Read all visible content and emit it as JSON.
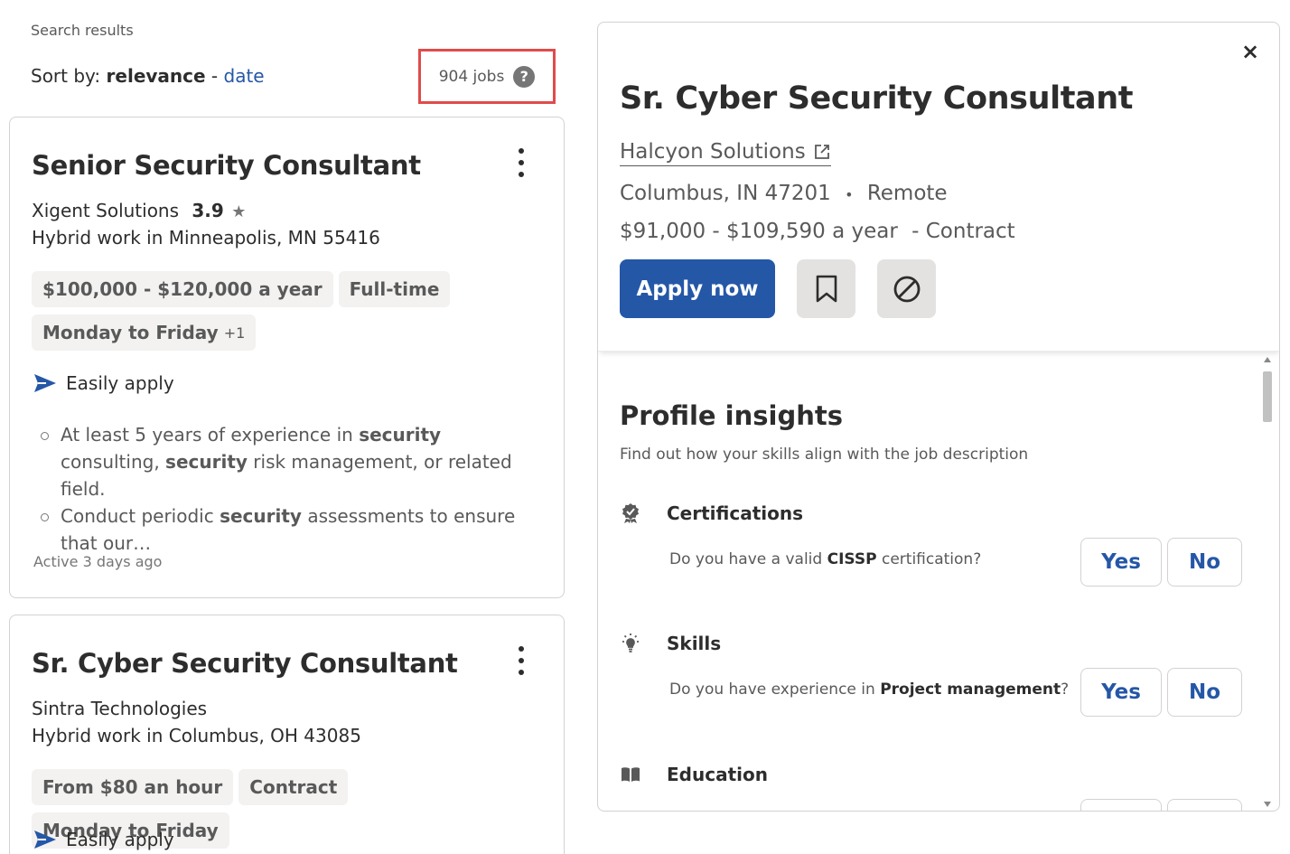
{
  "search": {
    "label": "Search results",
    "sort_prefix": "Sort by:",
    "sort_active": "relevance",
    "sort_sep": " - ",
    "sort_alt": "date",
    "job_count": "904 jobs",
    "help_glyph": "?"
  },
  "cards": [
    {
      "title": "Senior Security Consultant",
      "company": "Xigent Solutions",
      "rating": "3.9",
      "location": "Hybrid work in Minneapolis, MN 55416",
      "tags": [
        "$100,000 - $120,000 a year",
        "Full-time",
        "Monday to Friday"
      ],
      "tag_more": "+1",
      "easy_apply": "Easily apply",
      "snippet": {
        "b1_p1": "At least 5 years of experience in ",
        "b1_k1": "security",
        "b1_p2": " consulting, ",
        "b1_k2": "security",
        "b1_p3": " risk management, or related field.",
        "b2_p1": "Conduct periodic ",
        "b2_k1": "security",
        "b2_p2": " assessments to ensure that our…"
      },
      "active": "Active 3 days ago"
    },
    {
      "title": "Sr. Cyber Security Consultant",
      "company": "Sintra Technologies",
      "location": "Hybrid work in Columbus, OH 43085",
      "tags": [
        "From $80 an hour",
        "Contract",
        "Monday to Friday"
      ],
      "easy_apply": "Easily apply"
    }
  ],
  "detail": {
    "close_glyph": "×",
    "title": "Sr. Cyber Security Consultant",
    "company": "Halcyon Solutions",
    "location": "Columbus, IN 47201",
    "bullet": "•",
    "remote": "Remote",
    "salary": "$91,000 - $109,590 a year",
    "job_type": "- Contract",
    "apply_label": "Apply now",
    "insights_title": "Profile insights",
    "insights_sub": "Find out how your skills align with the job description",
    "sections": [
      {
        "heading": "Certifications",
        "icon": "badge-icon",
        "q_pre": "Do you have a valid ",
        "q_key": "CISSP",
        "q_post": " certification?",
        "yes": "Yes",
        "no": "No"
      },
      {
        "heading": "Skills",
        "icon": "lightbulb-icon",
        "q_pre": "Do you have experience in ",
        "q_key": "Project management",
        "q_post": "?",
        "yes": "Yes",
        "no": "No"
      },
      {
        "heading": "Education",
        "icon": "book-icon"
      }
    ]
  },
  "colors": {
    "accent": "#2557a7",
    "highlight_box": "#e04b4b",
    "tag_bg": "#f3f2f1",
    "text": "#2d2d2d",
    "muted": "#595959"
  }
}
